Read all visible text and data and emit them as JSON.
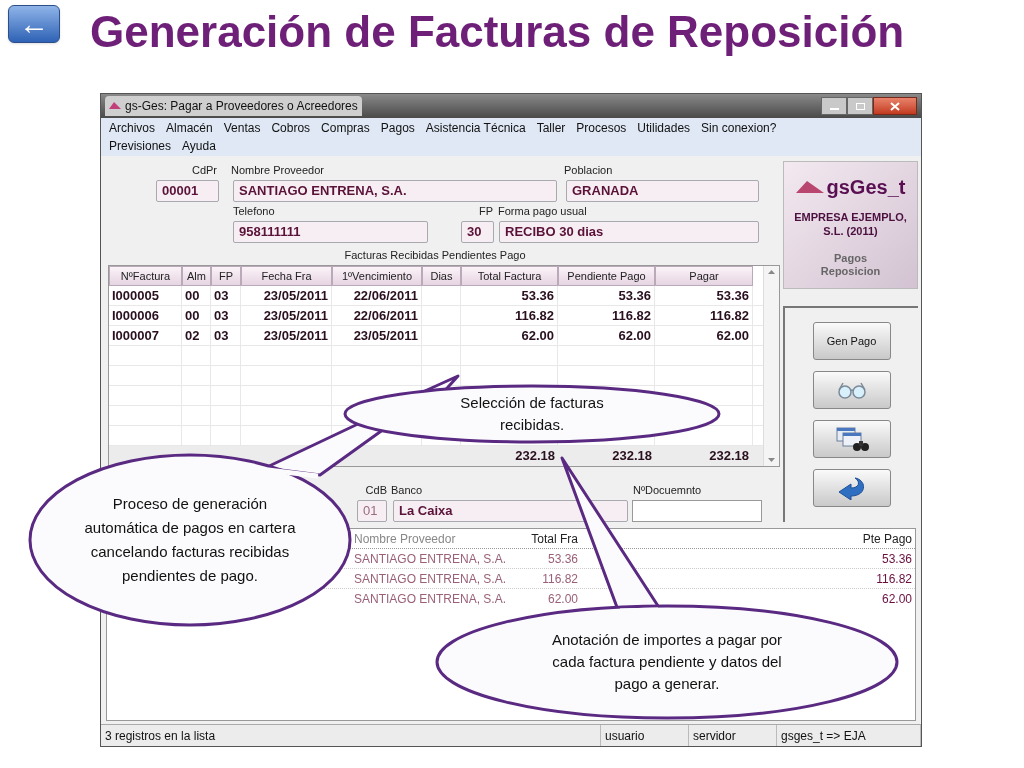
{
  "slide": {
    "back_button": "←",
    "title": "Generación de Facturas de Reposición"
  },
  "window": {
    "title": "gs-Ges: Pagar a Proveedores o Acreedores"
  },
  "menu": [
    [
      "Archivos",
      "Almacén",
      "Ventas",
      "Cobros",
      "Compras",
      "Pagos",
      "Asistencia Técnica",
      "Taller",
      "Procesos",
      "Utilidades",
      "Sin conexion?"
    ],
    [
      "Previsiones",
      "Ayuda"
    ]
  ],
  "supplier": {
    "code_label": "CdPr",
    "code": "00001",
    "name_label": "Nombre Proveedor",
    "name": "SANTIAGO ENTRENA, S.A.",
    "city_label": "Poblacion",
    "city": "GRANADA",
    "phone_label": "Telefono",
    "phone": "958111111",
    "fp_label": "FP",
    "fp": "30",
    "payment_label": "Forma pago usual",
    "payment": "RECIBO 30 dias"
  },
  "invoices": {
    "caption": "Facturas Recibidas Pendientes Pago",
    "columns": [
      "NºFactura",
      "Alm",
      "FP",
      "Fecha Fra",
      "1ºVencimiento",
      "Dias",
      "Total Factura",
      "Pendiente Pago",
      "Pagar"
    ],
    "rows": [
      [
        "I000005",
        "00",
        "03",
        "23/05/2011",
        "22/06/2011",
        "",
        "53.36",
        "53.36",
        "53.36"
      ],
      [
        "I000006",
        "00",
        "03",
        "23/05/2011",
        "22/06/2011",
        "",
        "116.82",
        "116.82",
        "116.82"
      ],
      [
        "I000007",
        "02",
        "03",
        "23/05/2011",
        "23/05/2011",
        "",
        "62.00",
        "62.00",
        "62.00"
      ]
    ],
    "totals": [
      "232.18",
      "232.18",
      "232.18"
    ]
  },
  "payment": {
    "bank_code_label": "CdB",
    "bank_code": "01",
    "bank_label": "Banco",
    "bank": "La Caixa",
    "doc_label": "NºDocuemnto"
  },
  "payments": {
    "columns": [
      "Nombre Proveedor",
      "Total Fra",
      "Pte Pago"
    ],
    "rows": [
      [
        "SANTIAGO ENTRENA, S.A.",
        "53.36",
        "53.36"
      ],
      [
        "SANTIAGO ENTRENA, S.A.",
        "116.82",
        "116.82"
      ],
      [
        "SANTIAGO ENTRENA, S.A.",
        "62.00",
        "62.00"
      ]
    ]
  },
  "brand": {
    "name": "gsGes_t",
    "company": "EMPRESA EJEMPLO, S.L. (2011)",
    "module": "Pagos Reposicion"
  },
  "actions": [
    {
      "kind": "text",
      "label": "Gen Pago"
    },
    {
      "kind": "glasses"
    },
    {
      "kind": "search-windows"
    },
    {
      "kind": "return"
    }
  ],
  "status_bar": [
    "3 registros en la lista",
    "usuario",
    "servidor",
    "gsges_t => EJA"
  ],
  "callouts": [
    "Selección de facturas recibidas.",
    "Proceso de generación automática de pagos en cartera cancelando facturas recibidas pendientes de pago.",
    "Anotación de importes a pagar por cada factura pendiente y datos del pago a generar."
  ]
}
